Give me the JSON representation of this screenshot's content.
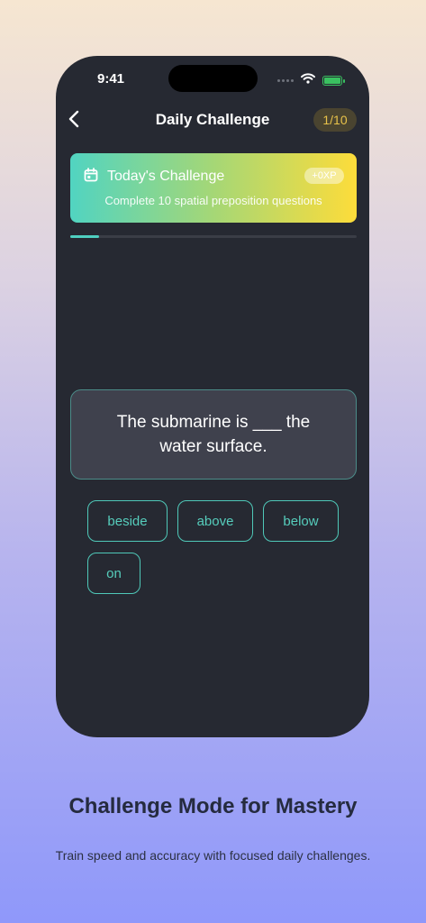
{
  "status_bar": {
    "time": "9:41",
    "icons": [
      "signal-dots-icon",
      "wifi-icon",
      "battery-icon"
    ],
    "battery_color": "#3ac160"
  },
  "header": {
    "title": "Daily Challenge",
    "progress": "1/10",
    "back_icon": "chevron-left-icon"
  },
  "banner": {
    "icon": "calendar-icon",
    "title": "Today's Challenge",
    "xp": "+0XP",
    "subtitle": "Complete 10 spatial preposition questions",
    "gradient": [
      "#51d4c1",
      "#a5d776",
      "#fddc3a"
    ]
  },
  "progress_bar": {
    "fraction": 0.1,
    "color": "#4fcfc0"
  },
  "question": {
    "text": "The submarine is ___ the water surface."
  },
  "options": [
    "beside",
    "above",
    "below",
    "on"
  ],
  "marketing": {
    "headline": "Challenge Mode for Mastery",
    "subtitle": "Train speed and accuracy with focused daily challenges."
  },
  "colors": {
    "accent": "#56cdbc",
    "phone_bg": "#262932",
    "badge_text": "#e8c24a"
  }
}
